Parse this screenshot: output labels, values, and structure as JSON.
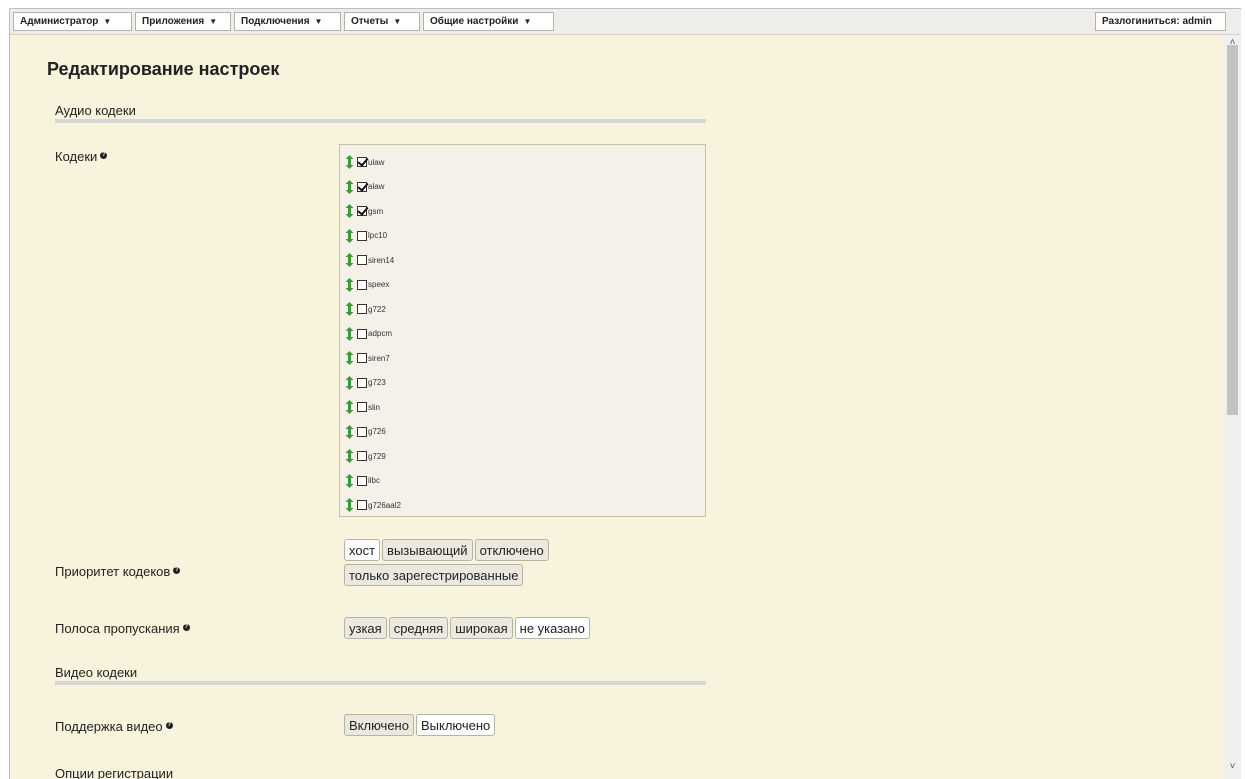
{
  "menu": {
    "items": [
      "Администратор",
      "Приложения",
      "Подключения",
      "Отчеты",
      "Общие настройки"
    ],
    "caret": "▼",
    "logout": "Разлогиниться: admin"
  },
  "page": {
    "title": "Редактирование настроек"
  },
  "sections": {
    "audio": "Аудио кодеки",
    "video": "Видео кодеки",
    "registration": "Опции регистрации"
  },
  "fields": {
    "codecs_label": "Кодеки",
    "priority_label": "Приоритет кодеков",
    "bandwidth_label": "Полоса пропускания",
    "video_label": "Поддержка видео"
  },
  "codecs": [
    {
      "name": "ulaw",
      "checked": true
    },
    {
      "name": "alaw",
      "checked": true
    },
    {
      "name": "gsm",
      "checked": true
    },
    {
      "name": "lpc10",
      "checked": false
    },
    {
      "name": "siren14",
      "checked": false
    },
    {
      "name": "speex",
      "checked": false
    },
    {
      "name": "g722",
      "checked": false
    },
    {
      "name": "adpcm",
      "checked": false
    },
    {
      "name": "siren7",
      "checked": false
    },
    {
      "name": "g723",
      "checked": false
    },
    {
      "name": "slin",
      "checked": false
    },
    {
      "name": "g726",
      "checked": false
    },
    {
      "name": "g729",
      "checked": false
    },
    {
      "name": "ilbc",
      "checked": false
    },
    {
      "name": "g726aal2",
      "checked": false
    }
  ],
  "priority_options": [
    "хост",
    "вызывающий",
    "отключено",
    "только зарегестрированные"
  ],
  "priority_selected": "хост",
  "bandwidth_options": [
    "узкая",
    "средняя",
    "широкая",
    "не указано"
  ],
  "bandwidth_selected": "не указано",
  "video_options": [
    "Включено",
    "Выключено"
  ],
  "video_selected": "Выключено",
  "colors": {
    "background": "#f7f3dc",
    "handle_arrow": "#3d9a3a",
    "rule": "#d6d6d6"
  },
  "icons": {
    "help": "question-circle-icon",
    "drag": "up-down-arrow-icon",
    "caret": "caret-down-icon"
  }
}
